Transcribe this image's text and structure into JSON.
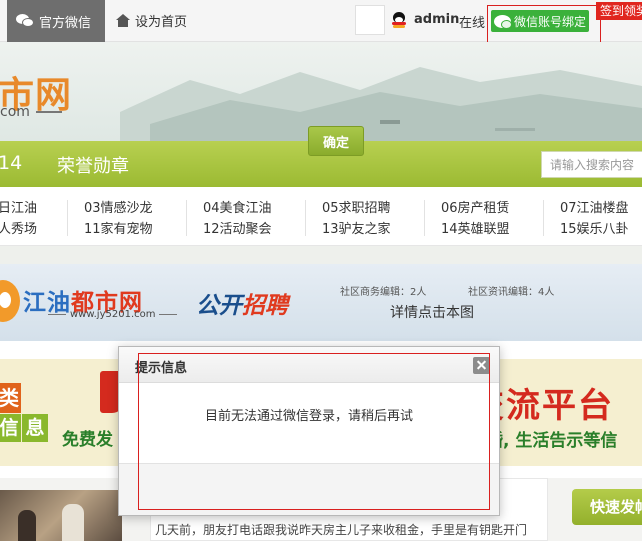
{
  "topbar": {
    "wechat_label": "官方微信",
    "home_label": "设为首页",
    "username": "admin",
    "online_label": "在线",
    "bind_wechat_label": "微信账号绑定",
    "sign_in_label": "签到领奖"
  },
  "banner": {
    "logo_text": "市网",
    "logo_sub": "com"
  },
  "nav": {
    "number_label": "14",
    "medal_label": "荣誉勋章",
    "search_placeholder": "请输入搜索内容"
  },
  "categories": [
    {
      "top": "日江油",
      "bottom": "人秀场"
    },
    {
      "top": "03情感沙龙",
      "bottom": "11家有宠物"
    },
    {
      "top": "04美食江油",
      "bottom": "12活动聚会"
    },
    {
      "top": "05求职招聘",
      "bottom": "13驴友之家"
    },
    {
      "top": "06房产租赁",
      "bottom": "14英雄联盟"
    },
    {
      "top": "07江油楼盘",
      "bottom": "15娱乐八卦"
    }
  ],
  "ad_recruit": {
    "brand_part1": "江油",
    "brand_part2": "都市网",
    "url": "www.jy5201.com",
    "title_part1": "公开",
    "title_part2": "招聘",
    "editor_business": "社区商务编辑：2人",
    "editor_news": "社区资讯编辑：4人",
    "detail_label": "详情点击本图"
  },
  "ad_platform": {
    "lei_char": "类",
    "info_char1": "信",
    "info_char2": "息",
    "free_label": "免费发",
    "platform_label": "交流平台",
    "sub_label": "婚, 生活告示等信"
  },
  "bottom": {
    "article_text": "几天前，朋友打电话跟我说昨天房主儿子来收租金，手里是有钥匙开门",
    "quick_post_label": "快速发帖"
  },
  "dialog": {
    "title": "提示信息",
    "message": "目前无法通过微信登录，请稍后再试",
    "ok_label": "确定"
  },
  "colors": {
    "nav_green": "#9bba32",
    "wechat_green": "#3bb13b",
    "highlight_red": "#d9201f"
  }
}
